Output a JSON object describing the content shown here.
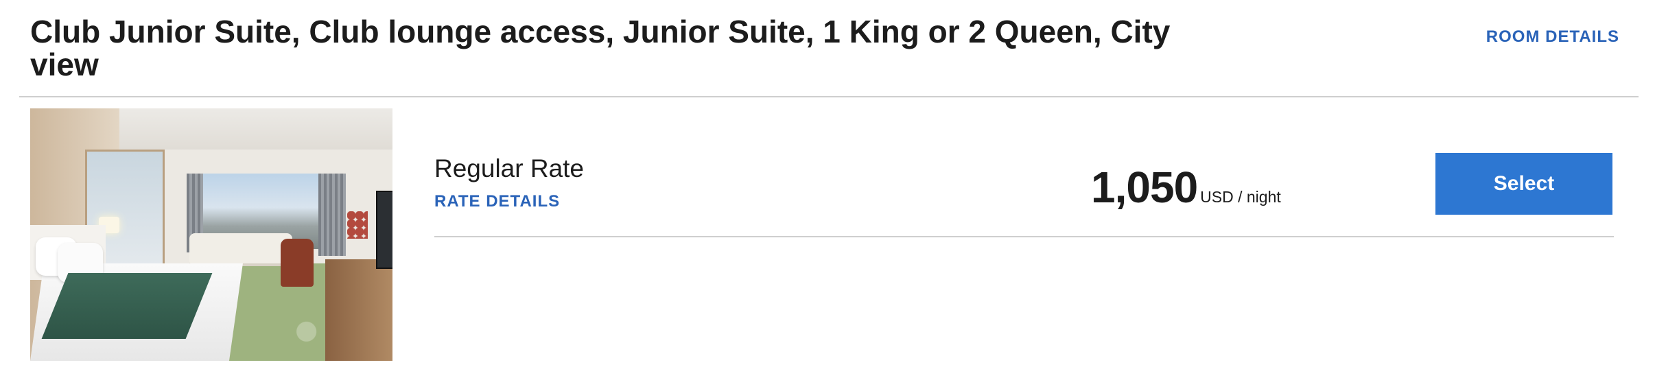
{
  "room": {
    "title": "Club Junior Suite, Club lounge access, Junior Suite, 1 King or 2 Queen, City view",
    "details_link": "ROOM DETAILS",
    "photo_alt": "Room photo"
  },
  "rate": {
    "name": "Regular Rate",
    "details_link": "RATE DETAILS",
    "price": "1,050",
    "price_unit": "USD / night",
    "select_label": "Select"
  },
  "colors": {
    "link": "#2a63b8",
    "button": "#2d77d2",
    "divider": "#cfcfcf"
  }
}
